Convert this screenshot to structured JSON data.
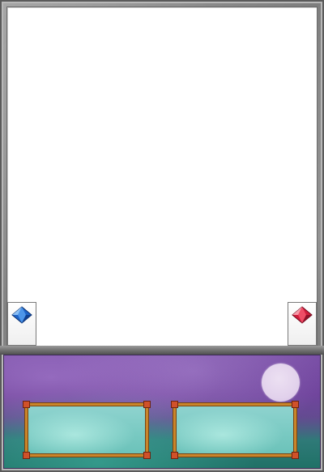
{
  "card": {
    "frame_color": "#8a8a8a",
    "art_background": "#ffffff",
    "panel_colors": {
      "top": "#7a4fa6",
      "bottom": "#1f7166"
    },
    "moon_color": "#e2d2ec",
    "frame_accent": "#c9852a"
  },
  "pendulum": {
    "left_icon": "blue-gem-icon",
    "right_icon": "red-gem-icon"
  }
}
